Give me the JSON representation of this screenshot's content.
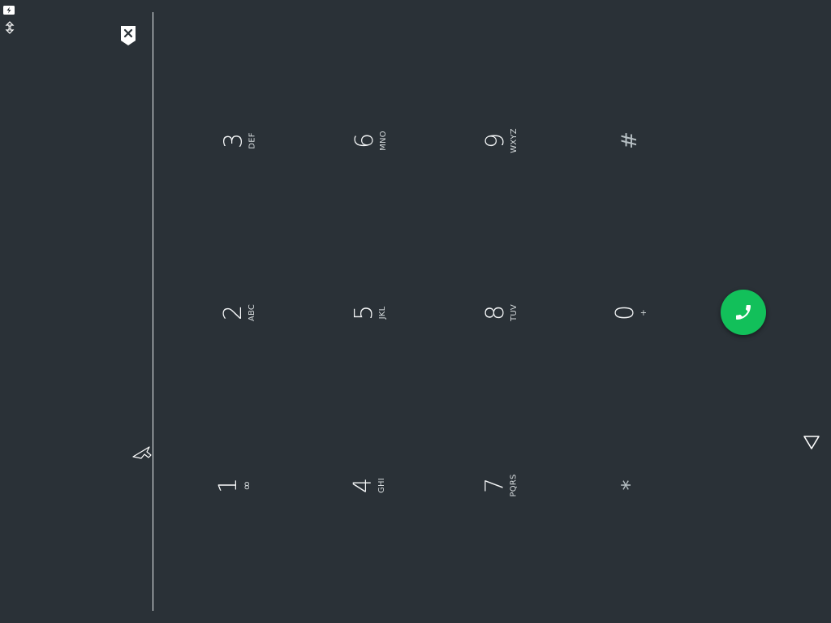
{
  "dialpad": {
    "keys": [
      {
        "digit": "1",
        "letters": "ꝏ"
      },
      {
        "digit": "2",
        "letters": "ABC"
      },
      {
        "digit": "3",
        "letters": "DEF"
      },
      {
        "digit": "4",
        "letters": "GHI"
      },
      {
        "digit": "5",
        "letters": "JKL"
      },
      {
        "digit": "6",
        "letters": "MNO"
      },
      {
        "digit": "7",
        "letters": "PQRS"
      },
      {
        "digit": "8",
        "letters": "TUV"
      },
      {
        "digit": "9",
        "letters": "WXYZ"
      },
      {
        "symbol": "*"
      },
      {
        "digit": "0",
        "letters": "+"
      },
      {
        "symbol": "#"
      }
    ]
  },
  "icons": {
    "battery": "battery-charging-icon",
    "sync": "sync-icon",
    "backspace": "backspace-icon",
    "call": "phone-icon",
    "back": "nav-back-icon",
    "cursor": "mouse-cursor-icon"
  },
  "colors": {
    "background": "#2a3137",
    "call_button": "#12c05a",
    "text": "#f4f6f7"
  }
}
